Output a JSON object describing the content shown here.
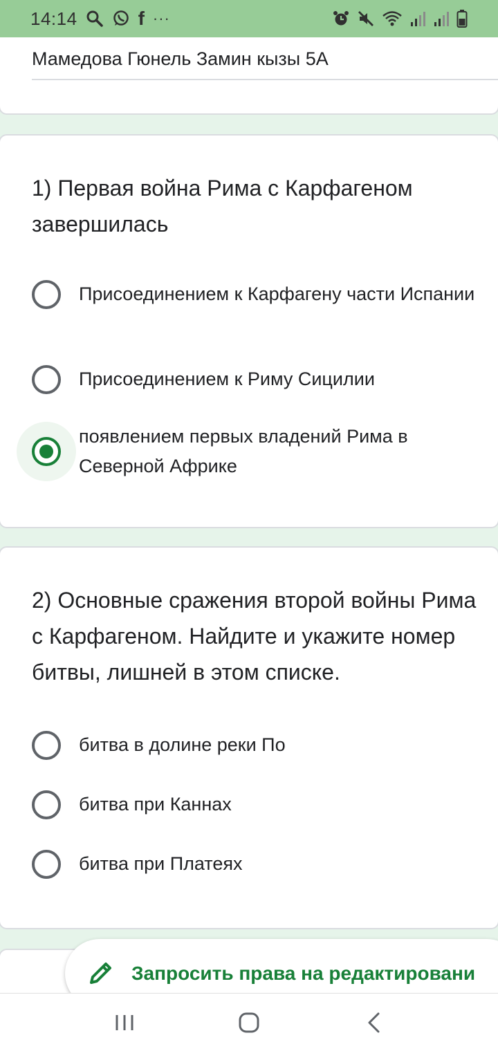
{
  "status_bar": {
    "time": "14:14",
    "left_icons": [
      "search-icon",
      "whatsapp-icon",
      "facebook-icon",
      "more-dots-icon"
    ],
    "facebook_glyph": "f",
    "more_glyph": "···",
    "right_icons": [
      "alarm-icon",
      "mute-icon",
      "wifi-icon",
      "signal-icon",
      "signal-icon",
      "battery-icon"
    ],
    "background": "#97cc97"
  },
  "name_field": {
    "value": "Мамедова Гюнель Замин кызы 5А"
  },
  "questions": [
    {
      "title": "1) Первая война Рима с Карфагеном завершилась",
      "options": [
        {
          "label": "Присоединением к Карфагену части Испании",
          "selected": false
        },
        {
          "label": "Присоединением к Риму Сицилии",
          "selected": false
        },
        {
          "label": "появлением первых владений Рима в Северной Африке",
          "selected": true
        }
      ]
    },
    {
      "title": "2) Основные сражения второй войны Рима с Карфагеном. Найдите и укажите номер битвы, лишней в этом списке.",
      "options": [
        {
          "label": "битва в долине реки По",
          "selected": false
        },
        {
          "label": "битва при Каннах",
          "selected": false
        },
        {
          "label": "битва при Платеях",
          "selected": false
        }
      ]
    }
  ],
  "edit_button": {
    "label": "Запросить права на редактировани",
    "icon": "pencil-icon"
  },
  "nav_bar": {
    "buttons": [
      "recent-apps-icon",
      "home-icon",
      "back-icon"
    ]
  },
  "colors": {
    "accent": "#188038",
    "page_background": "#e6f4ea",
    "radio_unselected": "#5f6368"
  }
}
